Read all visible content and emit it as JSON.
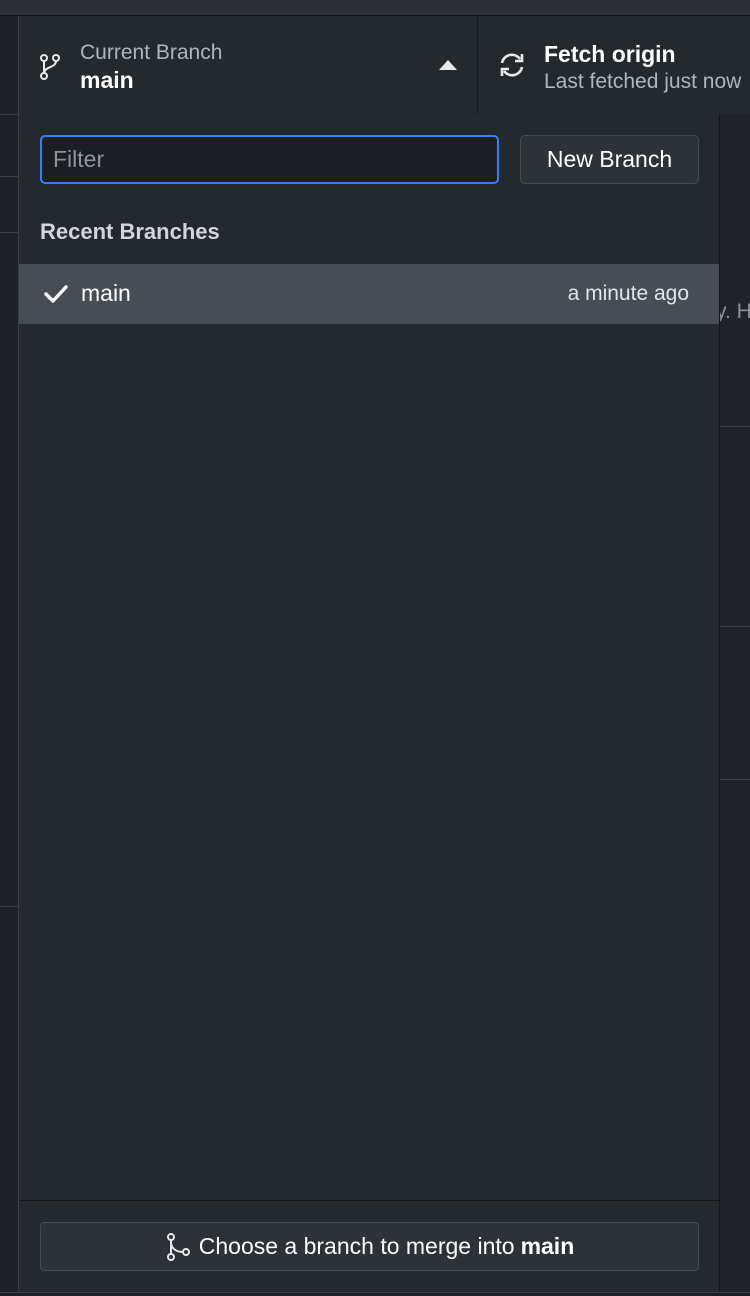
{
  "toolbar": {
    "branch_caption": "Current Branch",
    "branch_name": "main",
    "fetch_title": "Fetch origin",
    "fetch_subtitle": "Last fetched just now"
  },
  "background": {
    "peek_text": "y. H"
  },
  "dropdown": {
    "filter_placeholder": "Filter",
    "filter_value": "",
    "new_branch_label": "New Branch",
    "section_title": "Recent Branches",
    "branches": [
      {
        "name": "main",
        "time": "a minute ago",
        "selected": true
      }
    ],
    "merge_prefix": "Choose a branch to merge into",
    "merge_branch": "main"
  },
  "colors": {
    "accent": "#2f81f7",
    "panel": "#24292e",
    "selected_row": "#464d55"
  },
  "icons": [
    "git-branch-icon",
    "caret-up-icon",
    "sync-icon",
    "check-icon",
    "git-merge-icon"
  ]
}
